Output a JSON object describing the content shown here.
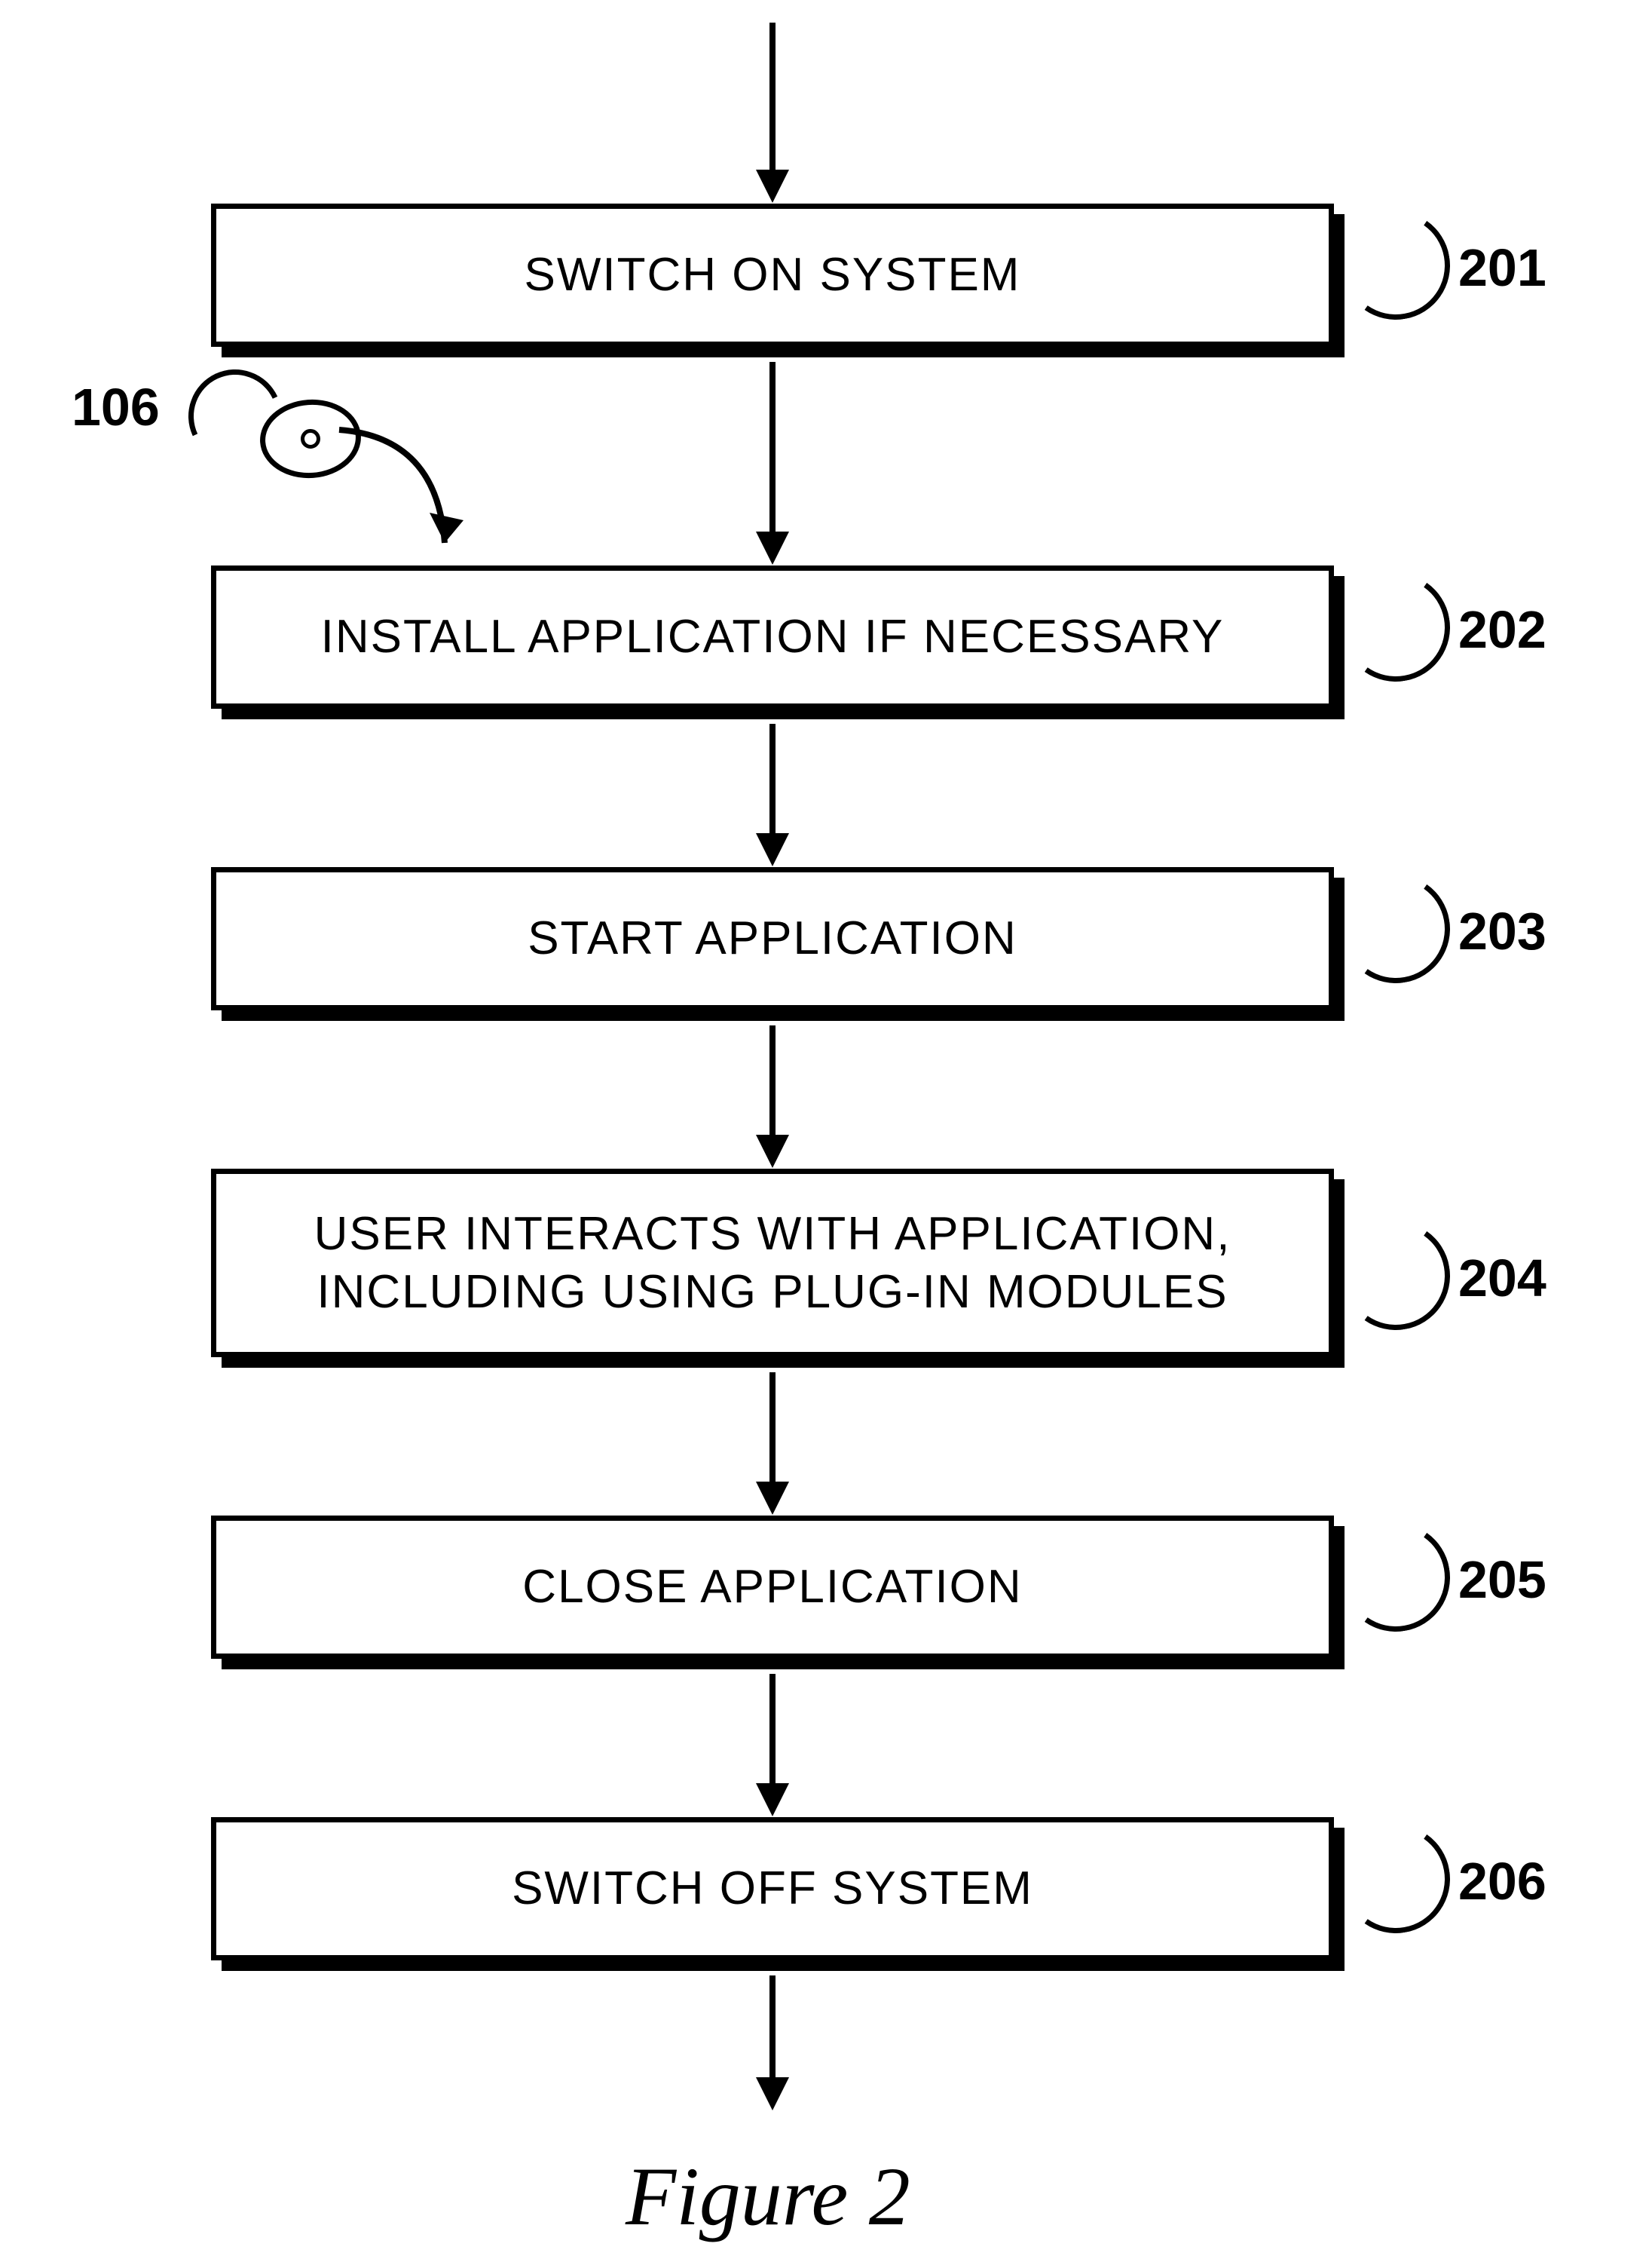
{
  "steps": [
    {
      "label": "SWITCH ON SYSTEM",
      "ref": "201"
    },
    {
      "label": "INSTALL APPLICATION IF NECESSARY",
      "ref": "202"
    },
    {
      "label": "START APPLICATION",
      "ref": "203"
    },
    {
      "label": "USER INTERACTS WITH APPLICATION,\nINCLUDING USING PLUG-IN MODULES",
      "ref": "204"
    },
    {
      "label": "CLOSE APPLICATION",
      "ref": "205"
    },
    {
      "label": "SWITCH OFF SYSTEM",
      "ref": "206"
    }
  ],
  "disc_ref": "106",
  "caption": "Figure 2"
}
